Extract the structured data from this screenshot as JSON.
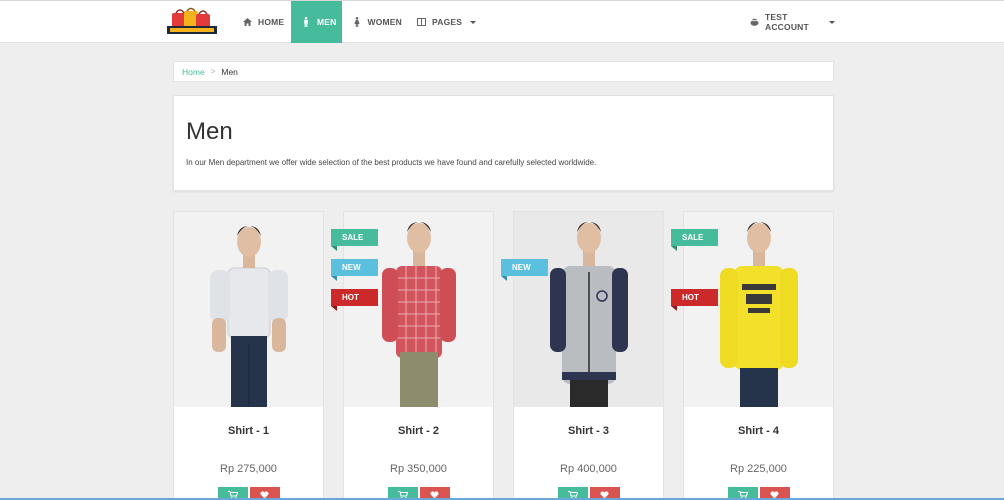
{
  "nav": {
    "items": [
      {
        "label": "HOME",
        "icon": "home-icon",
        "active": false
      },
      {
        "label": "MEN",
        "icon": "male-icon",
        "active": true
      },
      {
        "label": "WOMEN",
        "icon": "female-icon",
        "active": false
      },
      {
        "label": "PAGES",
        "icon": "columns-icon",
        "active": false,
        "dropdown": true
      }
    ],
    "account": {
      "label": "TEST ACCOUNT",
      "icon": "user-icon",
      "dropdown": true
    },
    "accent": "#46bc9d"
  },
  "breadcrumb": {
    "home": "Home",
    "separator": ">",
    "current": "Men"
  },
  "header": {
    "title": "Men",
    "description": "In our Men department we offer wide selection of the best products we have found and carefully selected worldwide."
  },
  "products": [
    {
      "name": "Shirt - 1",
      "price": "Rp 275,000",
      "badges": [],
      "shirt_color": "#e6e8ec"
    },
    {
      "name": "Shirt - 2",
      "price": "Rp 350,000",
      "badges": [
        "SALE",
        "NEW",
        "HOT"
      ],
      "shirt_color": "#d2545c"
    },
    {
      "name": "Shirt - 3",
      "price": "Rp 400,000",
      "badges": [
        "NEW"
      ],
      "shirt_color": "#b9bcc0"
    },
    {
      "name": "Shirt - 4",
      "price": "Rp 225,000",
      "badges": [
        "SALE",
        "HOT"
      ],
      "shirt_color": "#f2e02a"
    }
  ],
  "badge_colors": {
    "SALE": "#46bc9d",
    "NEW": "#5bc0de",
    "HOT": "#cc2a2a"
  },
  "buttons": {
    "cart_icon": "cart-icon",
    "fav_icon": "heart-icon"
  }
}
